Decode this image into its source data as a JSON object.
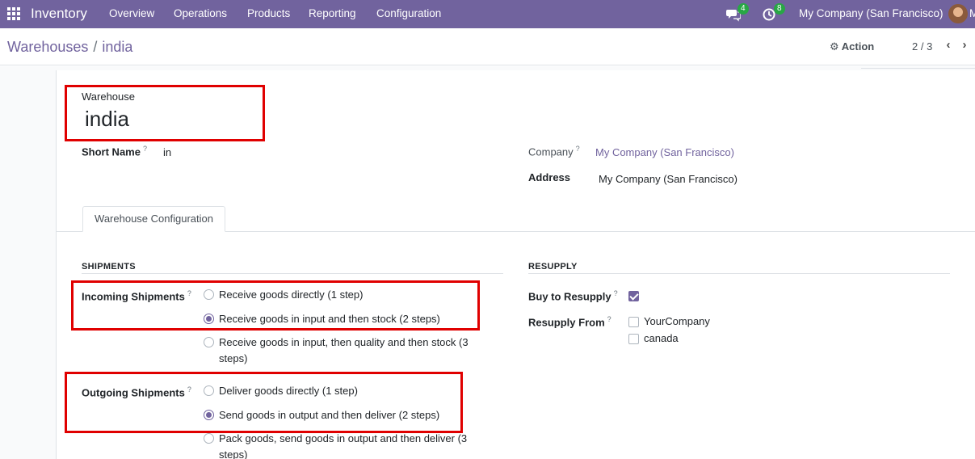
{
  "navbar": {
    "app_name": "Inventory",
    "menu": [
      "Overview",
      "Operations",
      "Products",
      "Reporting",
      "Configuration"
    ],
    "messages_count": "4",
    "activities_count": "8",
    "company": "My Company (San Francisco)",
    "user_initial": "M"
  },
  "breadcrumb": {
    "parent": "Warehouses",
    "separator": "/",
    "current": "india"
  },
  "control": {
    "action_label": "Action",
    "pager": "2 / 3"
  },
  "form": {
    "warehouse_label": "Warehouse",
    "warehouse_name": "india",
    "short_name_label": "Short Name",
    "short_name_value": "in",
    "company_label": "Company",
    "company_value": "My Company (San Francisco)",
    "address_label": "Address",
    "address_value": "My Company (San Francisco)",
    "help_mark": "?"
  },
  "tabs": [
    "Warehouse Configuration"
  ],
  "shipments": {
    "title": "SHIPMENTS",
    "incoming_label": "Incoming Shipments",
    "incoming_options": [
      {
        "label": "Receive goods directly (1 step)",
        "selected": false
      },
      {
        "label": "Receive goods in input and then stock (2 steps)",
        "selected": true
      },
      {
        "label": "Receive goods in input, then quality and then stock (3 steps)",
        "selected": false
      }
    ],
    "outgoing_label": "Outgoing Shipments",
    "outgoing_options": [
      {
        "label": "Deliver goods directly (1 step)",
        "selected": false
      },
      {
        "label": "Send goods in output and then deliver (2 steps)",
        "selected": true
      },
      {
        "label": "Pack goods, send goods in output and then deliver (3 steps)",
        "selected": false
      }
    ]
  },
  "resupply": {
    "title": "RESUPPLY",
    "buy_label": "Buy to Resupply",
    "buy_checked": true,
    "from_label": "Resupply From",
    "from_options": [
      {
        "label": "YourCompany",
        "checked": false
      },
      {
        "label": "canada",
        "checked": false
      }
    ]
  },
  "colors": {
    "brand": "#71639e",
    "highlight": "#e00000",
    "badge": "#28a745"
  }
}
